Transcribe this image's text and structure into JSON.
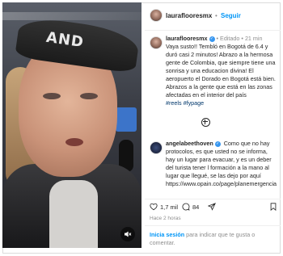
{
  "post": {
    "username": "lauraflooresmx",
    "follow_separator": "•",
    "follow_label": "Seguir"
  },
  "caption": {
    "username": "lauraflooresmx",
    "verified_icon": "verified-check-icon",
    "edited": "• Editado •",
    "age": "21 min",
    "text": "Vaya susto!! Tembló en Bogotá de 6.4 y duró casi 2 minutos! Abrazo a la hermosa gente de Colombia, que siempre tiene una sonrisa y una educacion divina! El aeropuerto el Dorado en Bogotá está bien. Abrazos a la gente que está en las zonas afectadas en el interior del país",
    "hashtags": "#reels #fypage"
  },
  "comment": {
    "username": "angelabeethoven",
    "verified_icon": "verified-check-icon",
    "text": "Como que no hay protocolos, es que usted no se informa, hay un lugar para evacuar, y es un deber del turista tener l formación a la mano al lugar que llegué, se las dejo por aquí https://www.opain.co/page/planemergencia"
  },
  "actions": {
    "likes": "1,7 mil",
    "comments": "84"
  },
  "timestamp": "Hace 2 horas",
  "login_prompt": {
    "link": "Inicia sesión",
    "rest": " para indicar que te gusta o comentar."
  },
  "colors": {
    "link_blue": "#0095f6",
    "hashtag": "#00376b",
    "muted": "#8e8e8e",
    "text": "#262626"
  },
  "video": {
    "cap_lettering": "AND"
  }
}
